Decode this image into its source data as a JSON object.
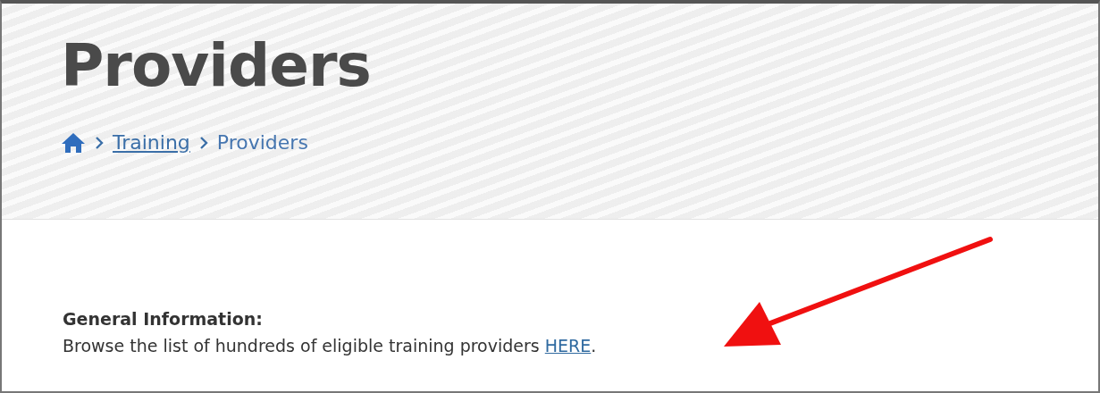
{
  "page_header": {
    "title": "Providers",
    "breadcrumb": [
      {
        "kind": "home"
      },
      {
        "kind": "link",
        "label": "Training"
      },
      {
        "kind": "current",
        "label": "Providers"
      }
    ]
  },
  "content": {
    "heading": "General Information:",
    "sentence": {
      "before": "Browse the list of hundreds of eligible training providers ",
      "link": "HERE",
      "after": "."
    }
  }
}
